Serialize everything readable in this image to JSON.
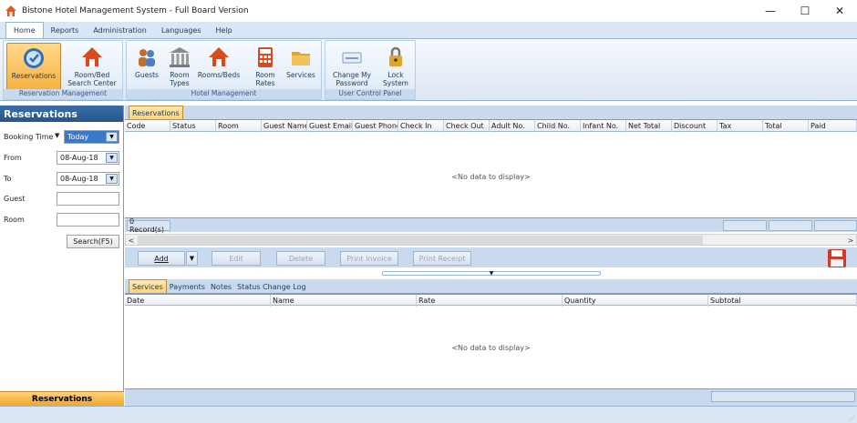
{
  "window": {
    "title": "Bistone Hotel Management System - Full Board Version",
    "minimize": "—",
    "maximize": "☐",
    "close": "✕"
  },
  "ribbon_tabs": [
    "Home",
    "Reports",
    "Administration",
    "Languages",
    "Help"
  ],
  "ribbon": {
    "groups": [
      {
        "label": "Reservation Management"
      },
      {
        "label": "Hotel Management"
      },
      {
        "label": "User Control Panel"
      }
    ],
    "buttons": {
      "reservations": "Reservations",
      "room_bed_search_1": "Room/Bed",
      "room_bed_search_2": "Search Center",
      "guests": "Guests",
      "room_types_1": "Room",
      "room_types_2": "Types",
      "rooms_beds": "Rooms/Beds",
      "room_rates_1": "Room",
      "room_rates_2": "Rates",
      "services": "Services",
      "change_password_1": "Change My",
      "change_password_2": "Password",
      "lock_system_1": "Lock",
      "lock_system_2": "System"
    }
  },
  "left_panel": {
    "header": "Reservations",
    "booking_time_label": "Booking Time",
    "booking_time_value": "Today",
    "from_label": "From",
    "from_value": "08-Aug-18",
    "to_label": "To",
    "to_value": "08-Aug-18",
    "guest_label": "Guest",
    "room_label": "Room",
    "search_button": "Search(F5)",
    "footer": "Reservations"
  },
  "reservations_grid": {
    "tab": "Reservations",
    "columns": [
      "Code",
      "Status",
      "Room",
      "Guest Name",
      "Guest Email",
      "Guest Phone",
      "Check In",
      "Check Out",
      "Adult No.",
      "Child No.",
      "Infant No.",
      "Net Total",
      "Discount",
      "Tax",
      "Total",
      "Paid"
    ],
    "empty_text": "<No data to display>",
    "record_count": "0 Record(s)"
  },
  "toolbar": {
    "add": "Add",
    "edit": "Edit",
    "delete": "Delete",
    "print_invoice": "Print Invoice",
    "print_receipt": "Print Receipt"
  },
  "detail_tabs": [
    "Services",
    "Payments",
    "Notes",
    "Status Change Log"
  ],
  "detail_grid": {
    "columns": [
      "Date",
      "Name",
      "Rate",
      "Quantity",
      "Subtotal"
    ],
    "empty_text": "<No data to display>"
  },
  "colors": {
    "accent_orange": "#f5a623",
    "ribbon_blue": "#dbe6f4",
    "header_blue": "#26558c"
  }
}
